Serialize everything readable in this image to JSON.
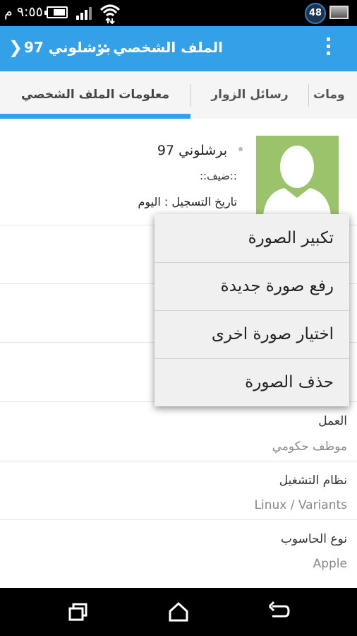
{
  "status_bar": {
    "time": "٩:٥٥ م",
    "badge": "48"
  },
  "app_bar": {
    "title": "الملف الشخصي ::",
    "profile_name": "برشلوني 97",
    "back_label": "❯"
  },
  "tabs": [
    {
      "label": "معلومات الملف الشخصي",
      "active": true
    },
    {
      "label": "رسائل الزوار",
      "active": false
    },
    {
      "label": "ومات",
      "active": false
    }
  ],
  "profile": {
    "name": "برشلوني 97",
    "role": "::ضيف::",
    "registration": "تاريخ التسجيل : اليوم"
  },
  "fields": [
    {
      "label": "العمل",
      "value": "موظف حكومي"
    },
    {
      "label": "نظام التشغيل",
      "value": "Linux / Variants"
    },
    {
      "label": "نوع الحاسوب",
      "value": "Apple"
    }
  ],
  "menu": {
    "items": [
      "تكبير الصورة",
      "رفع صورة جديدة",
      "اختيار صورة اخرى",
      "حذف الصورة"
    ]
  },
  "colors": {
    "primary": "#34a0e8",
    "avatar_bg": "#9ac36b"
  }
}
